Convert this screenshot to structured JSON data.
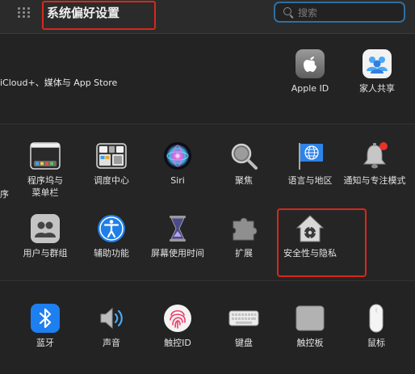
{
  "toolbar": {
    "title": "系统偏好设置",
    "search_placeholder": "搜索"
  },
  "account": {
    "label": "iCloud+、媒体与 App Store",
    "apple_id": "Apple ID",
    "family": "家人共享"
  },
  "row1": {
    "left_cut": "序",
    "dock_line1": "程序坞与",
    "dock_line2": "菜单栏",
    "mission": "调度中心",
    "siri": "Siri",
    "spotlight": "聚焦",
    "language": "语言与地区",
    "notifications": "通知与专注模式"
  },
  "row2": {
    "users": "用户与群组",
    "accessibility": "辅助功能",
    "screentime": "屏幕使用时间",
    "extensions": "扩展",
    "security": "安全性与隐私"
  },
  "row3": {
    "bluetooth": "蓝牙",
    "sound": "声音",
    "touchid": "触控ID",
    "keyboard": "键盘",
    "trackpad": "触控板",
    "mouse": "鼠标"
  }
}
